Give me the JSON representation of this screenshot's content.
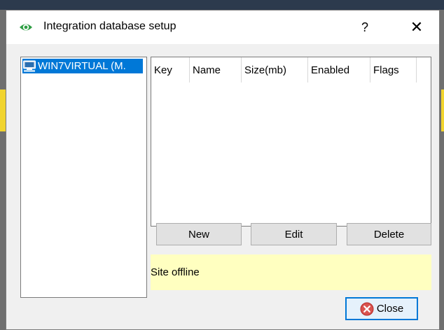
{
  "dialog": {
    "title": "Integration database setup",
    "help_label": "?",
    "close_glyph": "✕",
    "icon": "eye-icon"
  },
  "tree": {
    "items": [
      {
        "label": "WIN7VIRTUAL (M.",
        "icon": "computer-icon",
        "selected": true
      }
    ]
  },
  "table": {
    "columns": [
      "Key",
      "Name",
      "Size(mb)",
      "Enabled",
      "Flags"
    ],
    "rows": []
  },
  "buttons": {
    "new": "New",
    "edit": "Edit",
    "delete": "Delete",
    "close": "Close"
  },
  "status": {
    "text": "Site offline",
    "color": "#ffffc0"
  },
  "colors": {
    "selection": "#0078d7",
    "accent": "#0078d7"
  }
}
